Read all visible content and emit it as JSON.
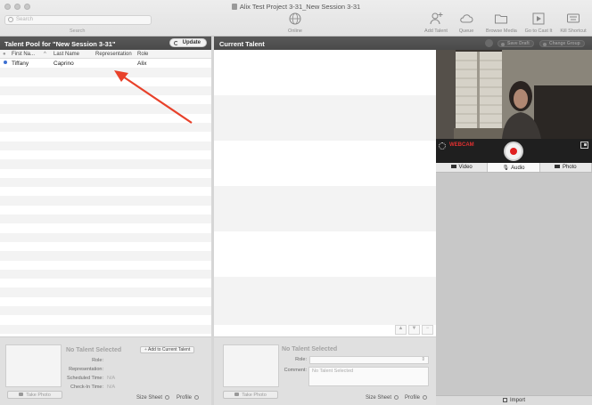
{
  "window": {
    "title": "Alix Test Project 3-31_New Session 3-31"
  },
  "toolbar": {
    "search_placeholder": "Search",
    "search_caption": "Search",
    "buttons": [
      {
        "label": "Online",
        "icon": "globe-icon"
      },
      {
        "label": "Add Talent",
        "icon": "add-person-icon"
      },
      {
        "label": "Queue",
        "icon": "cloud-icon"
      },
      {
        "label": "Browse Media",
        "icon": "folder-icon"
      },
      {
        "label": "Go to Cast It",
        "icon": "play-box-icon"
      },
      {
        "label": "Kill Shortcut",
        "icon": "keyboard-icon"
      }
    ]
  },
  "talent_pool": {
    "title": "Talent Pool for \"New Session 3-31\"",
    "update_label": "Update",
    "columns": [
      "First Na...",
      "Last Name",
      "Representation",
      "Role"
    ],
    "rows": [
      {
        "first": "Tiffany",
        "last": "Caprino",
        "representation": "",
        "role": "Alix",
        "status_color": "#3c6fd1"
      }
    ]
  },
  "left_detail": {
    "no_selection": "No Talent Selected",
    "add_to_current": "Add to Current Talent",
    "fields": [
      {
        "label": "Role:",
        "value": ""
      },
      {
        "label": "Representation:",
        "value": ""
      },
      {
        "label": "Scheduled Time:",
        "value": "N/A"
      },
      {
        "label": "Check-In Time:",
        "value": "N/A"
      }
    ],
    "take_photo": "Take Photo",
    "size_sheet": "Size Sheet",
    "profile": "Profile"
  },
  "current_talent": {
    "title": "Current Talent",
    "save_draft": "Save Draft",
    "change_group": "Change Group"
  },
  "center_detail": {
    "no_selection": "No Talent Selected",
    "role_label": "Role:",
    "comment_label": "Comment:",
    "comment_placeholder": "No Talent Selected",
    "take_photo": "Take Photo",
    "size_sheet": "Size Sheet",
    "profile": "Profile"
  },
  "recorder": {
    "status_label": "WEBCAM",
    "tabs": [
      "Video",
      "Audio",
      "Photo"
    ],
    "selected_tab": "Audio",
    "import_label": "Import"
  }
}
